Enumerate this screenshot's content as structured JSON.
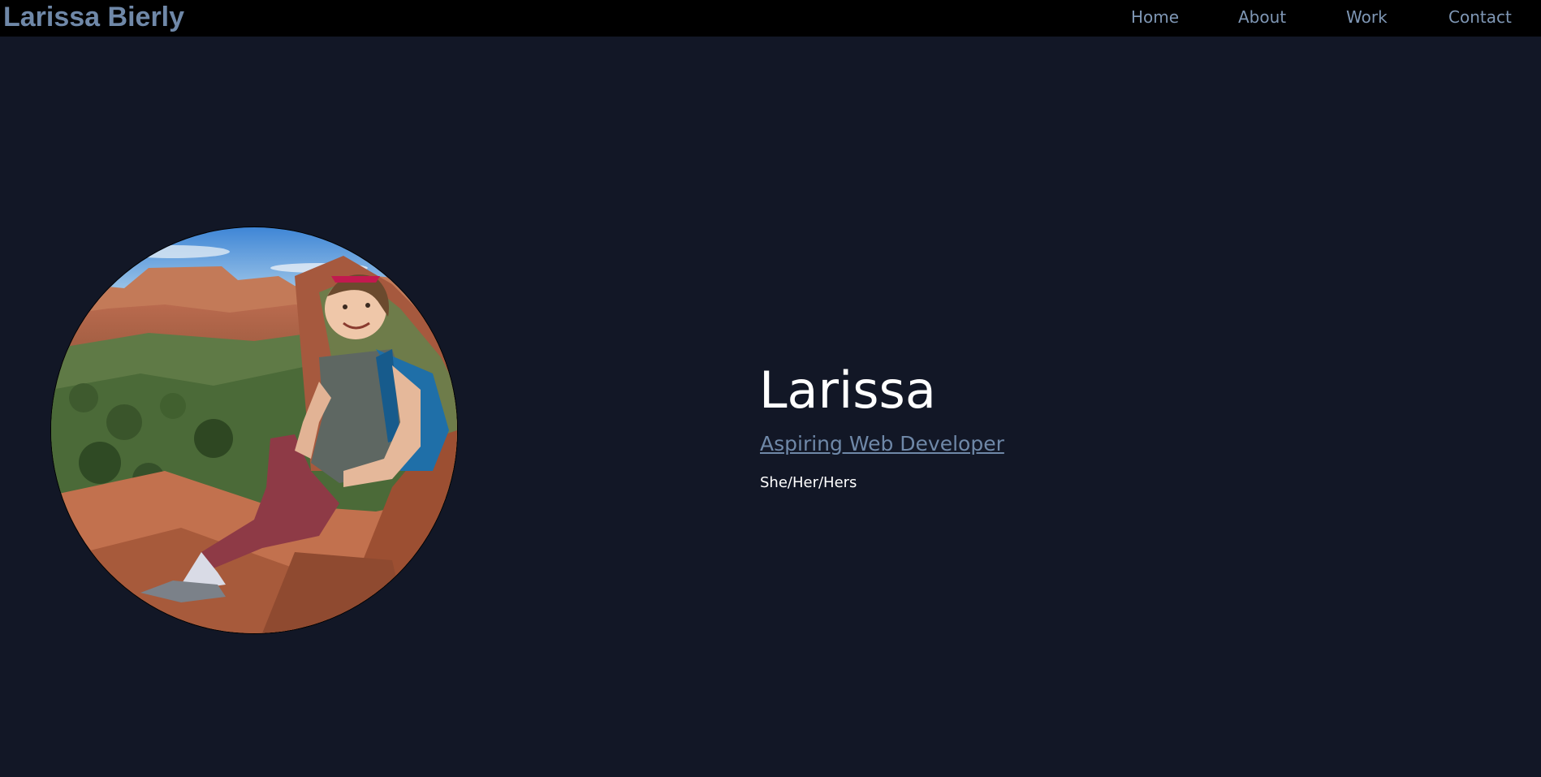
{
  "header": {
    "brand": "Larissa Bierly",
    "nav": [
      {
        "label": "Home"
      },
      {
        "label": "About"
      },
      {
        "label": "Work"
      },
      {
        "label": "Contact"
      }
    ]
  },
  "hero": {
    "photo": "hiker-portrait-photo",
    "name": "Larissa",
    "role": "Aspiring Web Developer",
    "pronouns": "She/Her/Hers"
  },
  "colors": {
    "background": "#121726",
    "header": "#000000",
    "accent": "#6f88a8",
    "text": "#ffffff"
  }
}
